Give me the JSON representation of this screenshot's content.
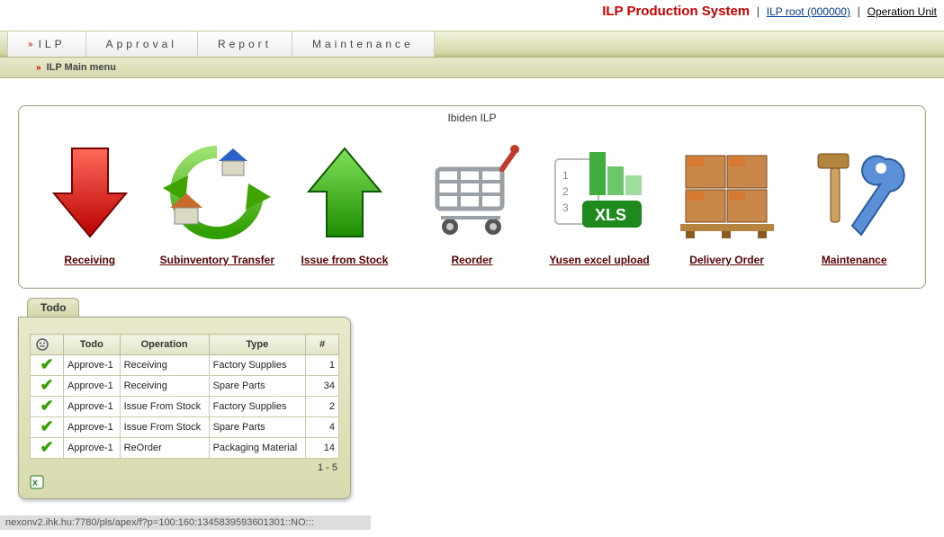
{
  "header": {
    "system_name": "ILP Production System",
    "user_label": "ILP root (000000)",
    "operation_unit_label": "Operation Unit"
  },
  "tabs": {
    "items": [
      "ILP",
      "Approval",
      "Report",
      "Maintenance"
    ]
  },
  "subtab": {
    "label": "ILP Main menu"
  },
  "panel": {
    "title": "Ibiden ILP",
    "icons": [
      {
        "label": "Receiving"
      },
      {
        "label": "Subinventory Transfer"
      },
      {
        "label": "Issue from Stock"
      },
      {
        "label": "Reorder"
      },
      {
        "label": "Yusen excel upload"
      },
      {
        "label": "Delivery Order"
      },
      {
        "label": "Maintenance"
      }
    ]
  },
  "todo": {
    "tab_label": "Todo",
    "columns": {
      "c0": "",
      "c1": "Todo",
      "c2": "Operation",
      "c3": "Type",
      "c4": "#"
    },
    "rows": [
      {
        "todo": "Approve-1",
        "op": "Receiving",
        "type": "Factory Supplies",
        "n": "1"
      },
      {
        "todo": "Approve-1",
        "op": "Receiving",
        "type": "Spare Parts",
        "n": "34"
      },
      {
        "todo": "Approve-1",
        "op": "Issue From Stock",
        "type": "Factory Supplies",
        "n": "2"
      },
      {
        "todo": "Approve-1",
        "op": "Issue From Stock",
        "type": "Spare Parts",
        "n": "4"
      },
      {
        "todo": "Approve-1",
        "op": "ReOrder",
        "type": "Packaging Material",
        "n": "14"
      }
    ],
    "range": "1 - 5"
  },
  "statusbar": "nexonv2.ihk.hu:7780/pls/apex/f?p=100:160:1345839593601301::NO:::"
}
